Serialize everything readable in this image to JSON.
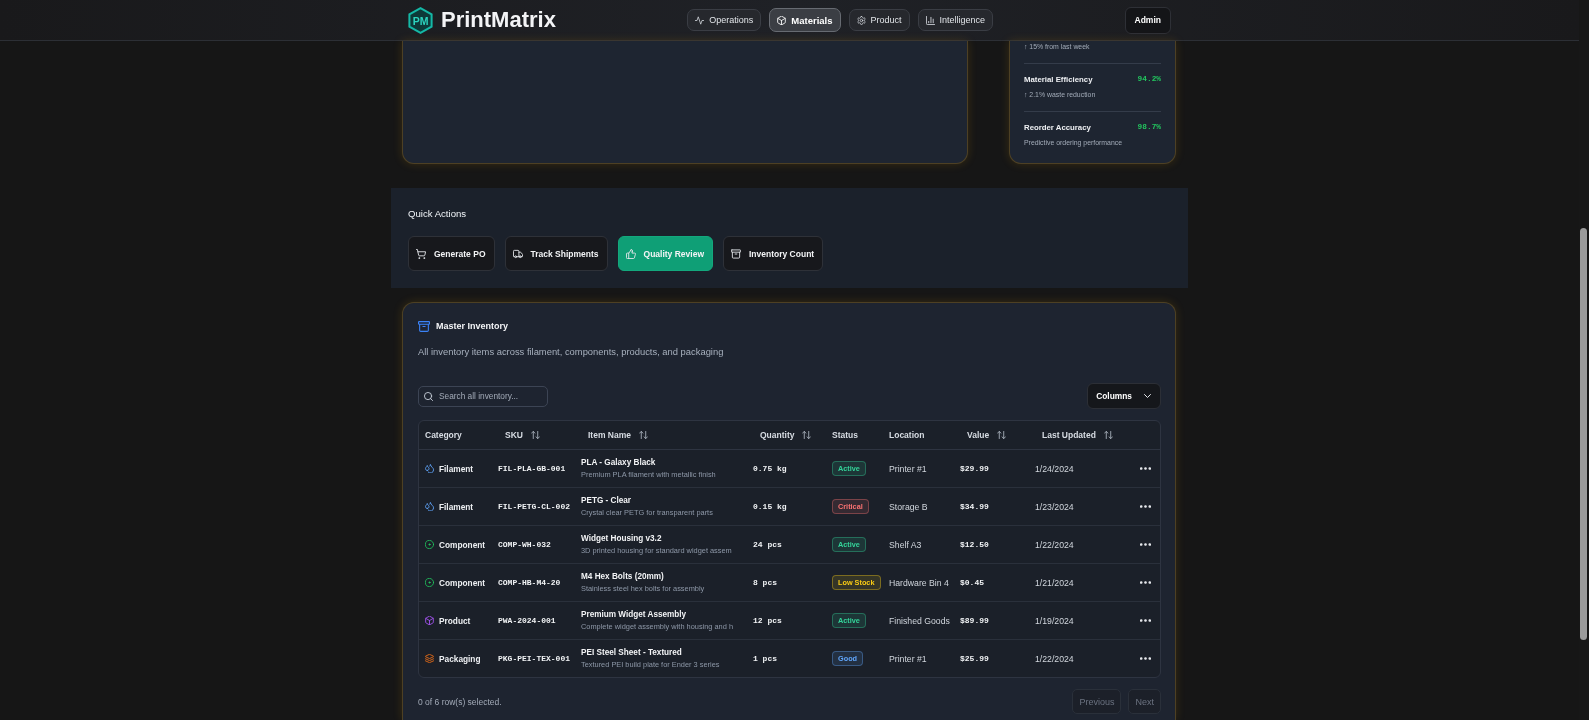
{
  "header": {
    "logo_mark": "PM",
    "brand": "PrintMatrix",
    "nav": [
      {
        "label": "Operations",
        "kind": "activity",
        "selected": false
      },
      {
        "label": "Materials",
        "kind": "box",
        "selected": true
      },
      {
        "label": "Product",
        "kind": "gear",
        "selected": false
      },
      {
        "label": "Intelligence",
        "kind": "chart",
        "selected": false
      }
    ],
    "user_button": "Admin"
  },
  "metrics": [
    {
      "note": "↑ 15% from last week"
    },
    {
      "label": "Material Efficiency",
      "value": "94.2%",
      "note": "↑ 2.1% waste reduction"
    },
    {
      "label": "Reorder Accuracy",
      "value": "98.7%",
      "note": "Predictive ordering performance"
    }
  ],
  "quick_actions": {
    "title": "Quick Actions",
    "buttons": [
      {
        "label": "Generate PO",
        "kind": "cart",
        "active": false
      },
      {
        "label": "Track Shipments",
        "kind": "truck",
        "active": false
      },
      {
        "label": "Quality Review",
        "kind": "thumbs-up",
        "active": true
      },
      {
        "label": "Inventory Count",
        "kind": "archive",
        "active": false
      }
    ]
  },
  "inventory": {
    "title": "Master Inventory",
    "subtitle": "All inventory items across filament, components, products, and packaging",
    "search": {
      "placeholder": "Search all inventory..."
    },
    "columns_button": "Columns",
    "table": {
      "columns": [
        {
          "label": "Category",
          "sortable": false
        },
        {
          "label": "SKU",
          "sortable": true
        },
        {
          "label": "Item Name",
          "sortable": true
        },
        {
          "label": "Quantity",
          "sortable": true
        },
        {
          "label": "Status",
          "sortable": false
        },
        {
          "label": "Location",
          "sortable": false
        },
        {
          "label": "Value",
          "sortable": true
        },
        {
          "label": "Last Updated",
          "sortable": true
        }
      ],
      "rows": [
        {
          "category": {
            "label": "Filament",
            "kind": "filament"
          },
          "sku": "FIL-PLA-GB-001",
          "name": "PLA - Galaxy Black",
          "description": "Premium PLA filament with metallic finish",
          "quantity": "0.75 kg",
          "status": {
            "label": "Active",
            "color": "#34d399"
          },
          "location": "Printer #1",
          "value": "$29.99",
          "updated": "1/24/2024"
        },
        {
          "category": {
            "label": "Filament",
            "kind": "filament"
          },
          "sku": "FIL-PETG-CL-002",
          "name": "PETG - Clear",
          "description": "Crystal clear PETG for transparent parts",
          "quantity": "0.15 kg",
          "status": {
            "label": "Critical",
            "color": "#f87171"
          },
          "location": "Storage B",
          "value": "$34.99",
          "updated": "1/23/2024"
        },
        {
          "category": {
            "label": "Component",
            "kind": "component"
          },
          "sku": "COMP-WH-032",
          "name": "Widget Housing v3.2",
          "description": "3D printed housing for standard widget assem",
          "quantity": "24 pcs",
          "status": {
            "label": "Active",
            "color": "#34d399"
          },
          "location": "Shelf A3",
          "value": "$12.50",
          "updated": "1/22/2024"
        },
        {
          "category": {
            "label": "Component",
            "kind": "component"
          },
          "sku": "COMP-HB-M4-20",
          "name": "M4 Hex Bolts (20mm)",
          "description": "Stainless steel hex bolts for assembly",
          "quantity": "8 pcs",
          "status": {
            "label": "Low Stock",
            "color": "#facc15"
          },
          "location": "Hardware Bin 4",
          "value": "$0.45",
          "updated": "1/21/2024"
        },
        {
          "category": {
            "label": "Product",
            "kind": "product"
          },
          "sku": "PWA-2024-001",
          "name": "Premium Widget Assembly",
          "description": "Complete widget assembly with housing and h",
          "quantity": "12 pcs",
          "status": {
            "label": "Active",
            "color": "#34d399"
          },
          "location": "Finished Goods",
          "value": "$89.99",
          "updated": "1/19/2024"
        },
        {
          "category": {
            "label": "Packaging",
            "kind": "packaging"
          },
          "sku": "PKG-PEI-TEX-001",
          "name": "PEI Steel Sheet - Textured",
          "description": "Textured PEI build plate for Ender 3 series",
          "quantity": "1 pcs",
          "status": {
            "label": "Good",
            "color": "#60a5fa"
          },
          "location": "Printer #1",
          "value": "$25.99",
          "updated": "1/22/2024"
        }
      ]
    },
    "selection_summary": "0 of 6 row(s) selected.",
    "pagination": [
      {
        "label": "Previous",
        "disabled": true
      },
      {
        "label": "Next",
        "disabled": true
      }
    ]
  }
}
